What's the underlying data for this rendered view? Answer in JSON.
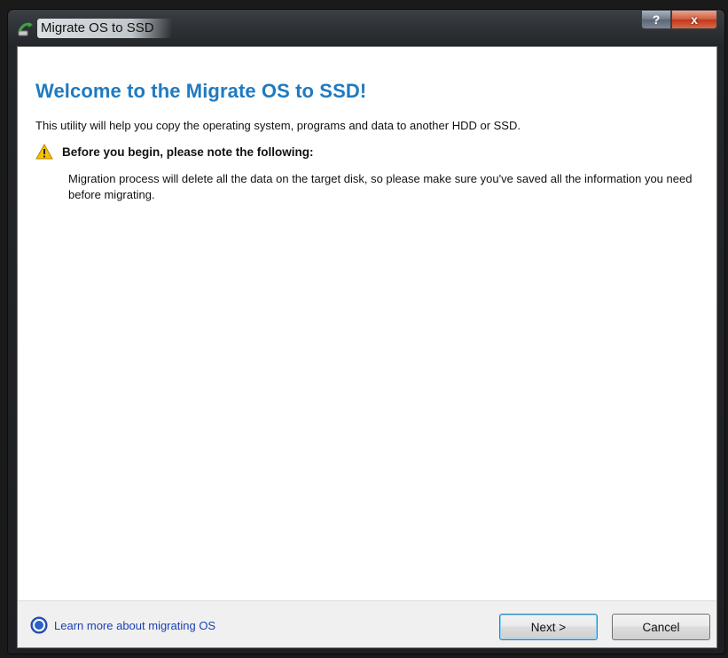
{
  "window": {
    "title": "Migrate OS to SSD",
    "help_label": "?",
    "close_label": "x"
  },
  "content": {
    "heading": "Welcome to the Migrate OS to SSD!",
    "intro": "This utility will help you copy the operating system, programs and data to another HDD or SSD.",
    "note_title": "Before you begin, please note the following:",
    "note_body": "Migration process will delete all the data on the target disk, so please make sure you've saved all the information you need before migrating."
  },
  "footer": {
    "learn_more_link": "Learn more about migrating OS",
    "next_button": "Next >",
    "cancel_button": "Cancel"
  },
  "colors": {
    "heading": "#1f7ac1",
    "link": "#1b3fb3",
    "close_button": "#c1381a",
    "warning": "#f2c200"
  },
  "icons": {
    "app": "migrate-os-app-icon",
    "warning": "warning-icon",
    "help": "help-circle-icon"
  }
}
